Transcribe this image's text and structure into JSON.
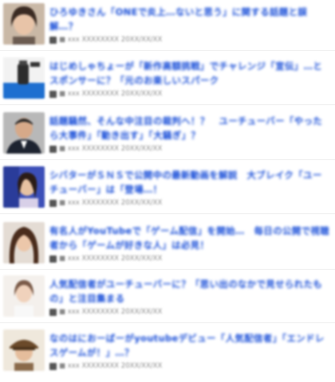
{
  "articles": [
    {
      "title": "ひろゆきさん「ONEで炎上…ないと思う」に関する話題と誤解…？",
      "source": "■ xxx  XXXXXXXX  20XX/XX/XX",
      "thumb": "woman-portrait"
    },
    {
      "title": "はじめしゃちょーが「新作高額挑戦」でチャレンジ「宣伝」…とスポンサーに？「元のお楽しいスパーク",
      "source": "■ xxx  XXXXXXXX  20XX/XX/XX",
      "thumb": "product-water"
    },
    {
      "title": "話題騒然、そんな中注目の裁判へ！？　ユーチューバー「やったら大事件」「動き出す」「大騒ぎ」？",
      "source": "■ xxx  XXXXXXXX  20XX/XX/XX",
      "thumb": "man-suit"
    },
    {
      "title": "シバターがＳＮＳで公開中の最新動画を解説　大ブレイク「ユーチューバー」は「登場…！",
      "source": "■ xxx  XXXXXXXX  20XX/XX/XX",
      "thumb": "woman-blue"
    },
    {
      "title": "有名人がYouTubeで「ゲーム配信」を開始…　毎日の公開で視聴者から「ゲームが好きな人」は必見！",
      "source": "■ xxx  XXXXXXXX  20XX/XX/XX",
      "thumb": "woman-hair"
    },
    {
      "title": "人気配信者がユーチューバーに？「思い出のなかで見せられたもの」と注目集まる",
      "source": "■ xxx  XXXXXXXX  20XX/XX/XX",
      "thumb": "woman-light"
    },
    {
      "title": "なのはにおーばーがyoutubeデビュー「人気配信者」「エンドレスゲームが！」…？",
      "source": "■ xxx  XXXXXXXX  20XX/XX/XX",
      "thumb": "person-hat"
    }
  ]
}
